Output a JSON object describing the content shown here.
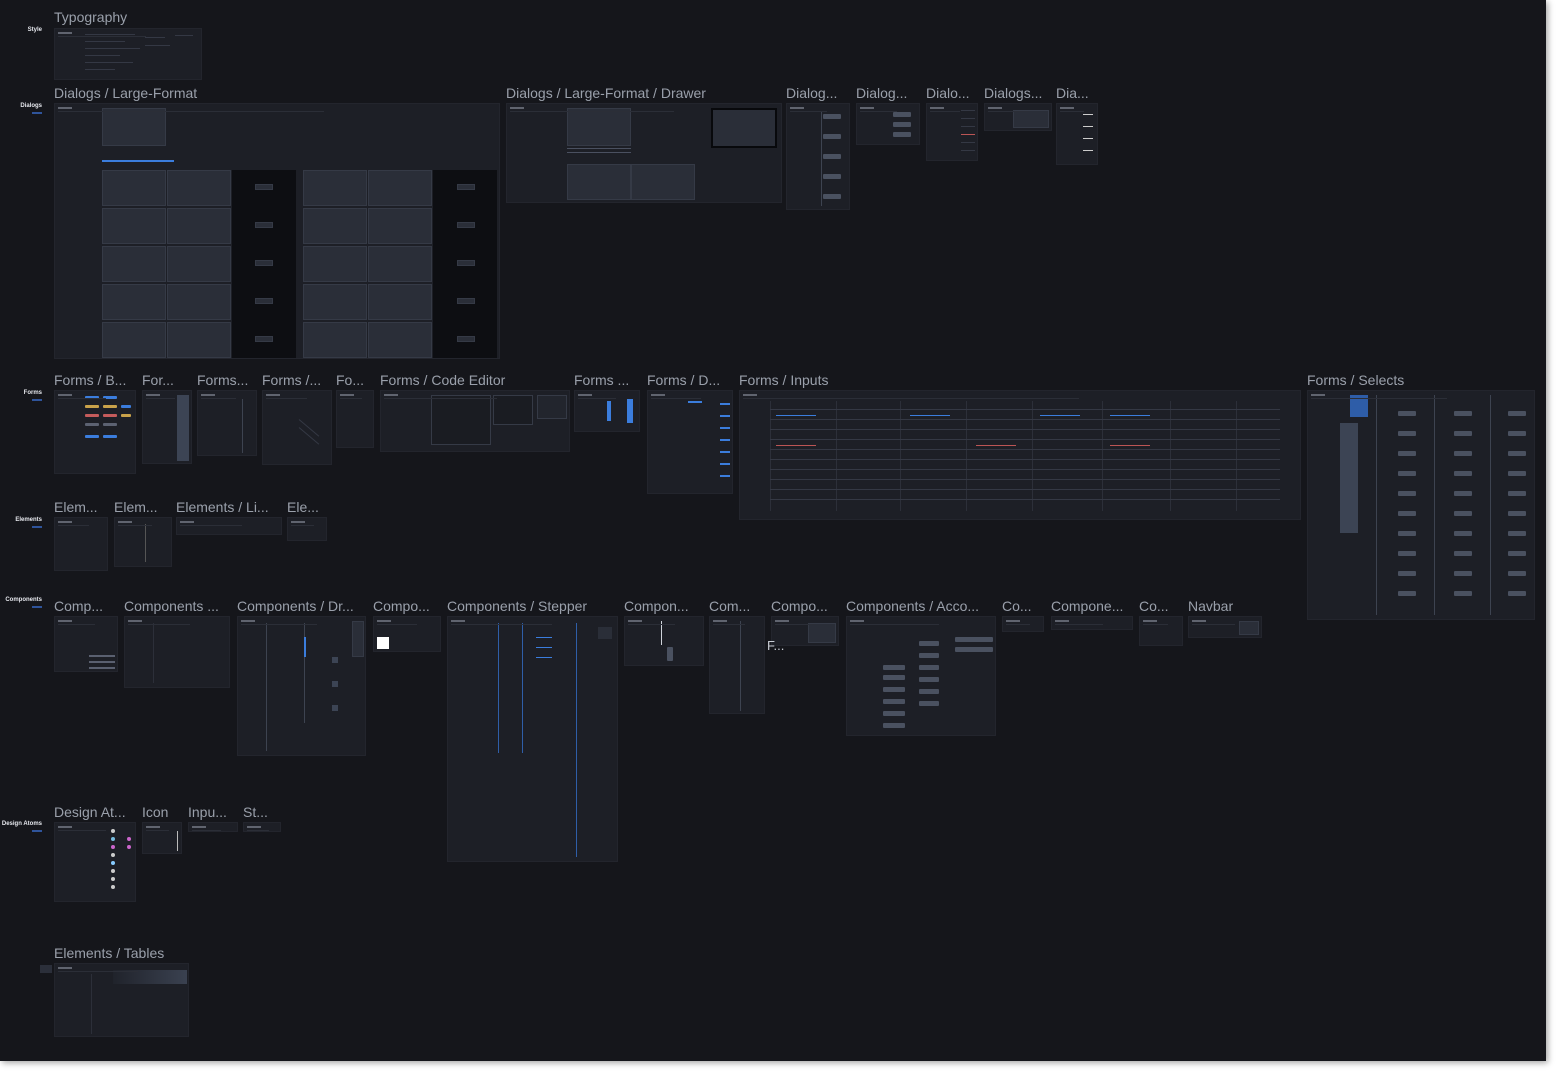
{
  "sections": [
    {
      "name": "Style"
    },
    {
      "name": "Dialogs"
    },
    {
      "name": "Forms"
    },
    {
      "name": "Elements"
    },
    {
      "name": "Components"
    },
    {
      "name": "Design Atoms"
    }
  ],
  "frames": {
    "typography": "Typography",
    "dialogs_large_format": "Dialogs / Large-Format",
    "dialogs_drawer": "Dialogs / Large-Format / Drawer",
    "dialogs_3": "Dialog...",
    "dialogs_4": "Dialog...",
    "dialogs_5": "Dialo...",
    "dialogs_6": "Dialogs...",
    "dialogs_7": "Dia...",
    "forms_b": "Forms / B...",
    "forms_2": "For...",
    "forms_3": "Forms...",
    "forms_4": "Forms /...",
    "forms_5": "Fo...",
    "forms_code_editor": "Forms / Code Editor",
    "forms_7": "Forms ...",
    "forms_d": "Forms / D...",
    "forms_inputs": "Forms / Inputs",
    "forms_selects": "Forms / Selects",
    "elements_1": "Elem...",
    "elements_2": "Elem...",
    "elements_li": "Elements / Li...",
    "elements_4": "Ele...",
    "components_1": "Comp...",
    "components_2": "Components ...",
    "components_dr": "Components / Dr...",
    "components_4": "Compo...",
    "components_stepper": "Components / Stepper",
    "components_6": "Compon...",
    "components_7": "Com...",
    "components_8": "Compo...",
    "components_acco": "Components / Acco...",
    "components_10": "Co...",
    "components_11": "Compone...",
    "components_12": "Co...",
    "navbar": "Navbar",
    "design_at": "Design At...",
    "icon": "Icon",
    "inpu": "Inpu...",
    "st": "St...",
    "elements_tables": "Elements / Tables",
    "floating_text": "F..."
  }
}
